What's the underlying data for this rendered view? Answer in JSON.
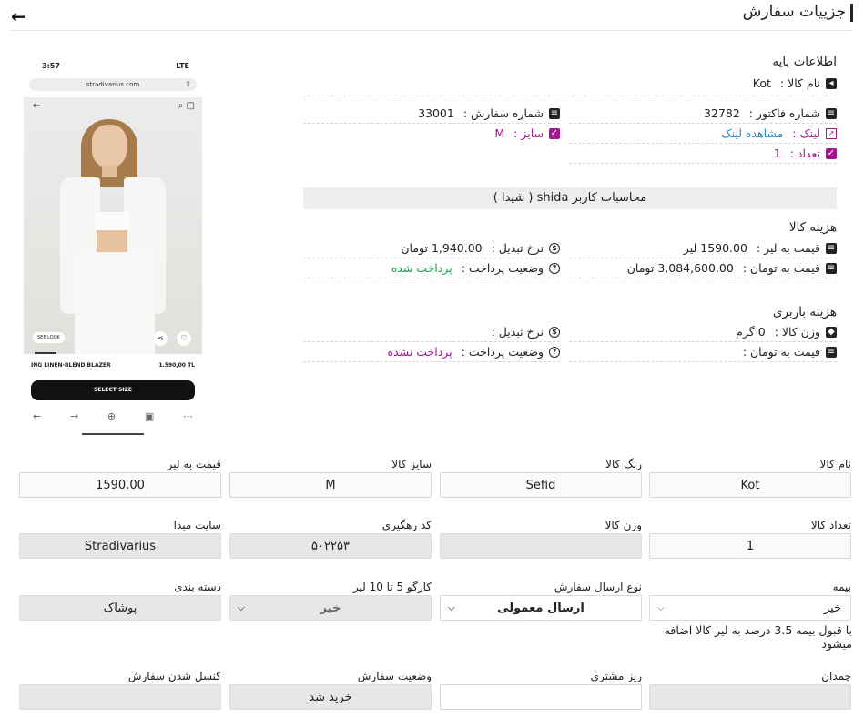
{
  "header": {
    "title": "جزییات سفارش",
    "back_icon": "arrow-left-icon"
  },
  "phone": {
    "time": "3:57",
    "signal": "LTE",
    "url": "stradivarius.com",
    "see_look": "SEE LOOK",
    "product_name": "ING LINEN-BLEND BLAZER",
    "product_price": "1.590,00 TL",
    "select_size": "SELECT SIZE"
  },
  "basic": {
    "title": "اطلاعات پایه",
    "product_name_label": "نام کالا :",
    "product_name_value": "Kot",
    "invoice_label": "شماره فاکتور :",
    "invoice_value": "32782",
    "order_label": "شماره سفارش :",
    "order_value": "33001",
    "link_label": "لینک :",
    "link_value": "مشاهده لینک",
    "size_label": "سایز :",
    "size_value": "M",
    "count_label": "تعداد :",
    "count_value": "1"
  },
  "calc": {
    "title": "محاسبات کاربر shida ( شیدا )",
    "goods_cost": {
      "title": "هزینه کالا",
      "lira_price_label": "قیمت به لیر :",
      "lira_price_value": "1590.00 لیر",
      "rate_label": "نرخ تبدیل :",
      "rate_value": "1,940.00 تومان",
      "toman_price_label": "قیمت به تومان :",
      "toman_price_value": "3,084,600.00 تومان",
      "pay_status_label": "وضعیت پرداخت :",
      "pay_status_value": "پرداخت شده"
    },
    "cargo_cost": {
      "title": "هزینه باربری",
      "weight_label": "وزن کالا :",
      "weight_value": "0 گرم",
      "rate_label": "نرخ تبدیل :",
      "rate_value": "",
      "toman_price_label": "قیمت به تومان :",
      "toman_price_value": "",
      "pay_status_label": "وضعیت پرداخت :",
      "pay_status_value": "پرداخت نشده"
    }
  },
  "form": {
    "product_name": {
      "label": "نام کالا",
      "value": "Kot"
    },
    "color": {
      "label": "رنگ کالا",
      "value": "Sefid"
    },
    "size": {
      "label": "سایز کالا",
      "value": "M"
    },
    "lira_price": {
      "label": "قیمت به لیر",
      "value": "1590.00"
    },
    "count": {
      "label": "تعداد کالا",
      "value": "1"
    },
    "weight": {
      "label": "وزن کالا",
      "value": ""
    },
    "tracking": {
      "label": "کد رهگیری",
      "value": "۵۰۲۲۵۳"
    },
    "source_site": {
      "label": "سایت مبدا",
      "value": "Stradivarius"
    },
    "insurance": {
      "label": "بیمه",
      "value": "خیر"
    },
    "shipping_type": {
      "label": "نوع ارسال سفارش",
      "value": "ارسال معمولی"
    },
    "cargo": {
      "label": "کارگو 5 تا 10 لیر",
      "value": "خیر"
    },
    "category": {
      "label": "دسته بندی",
      "value": "پوشاک"
    },
    "insurance_note": "با قبول بیمه 3.5 درصد به لیر کالا اضافه میشود",
    "luggage": {
      "label": "چمدان",
      "value": ""
    },
    "customer_detail": {
      "label": "ریز مشتری",
      "value": ""
    },
    "order_status": {
      "label": "وضعیت سفارش",
      "value": "خرید شد"
    },
    "cancel_order": {
      "label": "کنسل شدن سفارش",
      "value": ""
    }
  }
}
